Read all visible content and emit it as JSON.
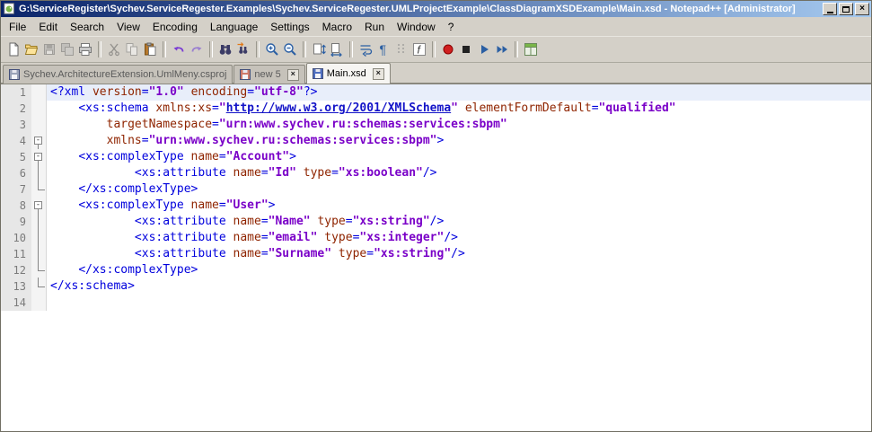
{
  "window": {
    "title": "G:\\ServiceRegister\\Sychev.ServiceRegester.Examples\\Sychev.ServiceRegester.UMLProjectExample\\ClassDiagramXSDExample\\Main.xsd - Notepad++ [Administrator]",
    "controls": [
      "minimize",
      "restore",
      "close"
    ]
  },
  "menu": {
    "items": [
      "File",
      "Edit",
      "Search",
      "View",
      "Encoding",
      "Language",
      "Settings",
      "Macro",
      "Run",
      "Window",
      "?"
    ]
  },
  "toolbar": {
    "groups": [
      [
        "new-file",
        "open",
        "save",
        "save-all",
        "print"
      ],
      [
        "cut",
        "copy",
        "paste"
      ],
      [
        "undo",
        "redo"
      ],
      [
        "find",
        "replace"
      ],
      [
        "zoom-in",
        "zoom-out"
      ],
      [
        "sync-vertical",
        "sync-horizontal"
      ],
      [
        "word-wrap",
        "show-all-characters",
        "show-indent-guide",
        "function-list"
      ],
      [
        "macro-record",
        "macro-stop",
        "macro-play",
        "macro-run-multiple"
      ],
      [
        "doc-switcher"
      ]
    ],
    "disabled": [
      "save",
      "save-all",
      "cut",
      "copy"
    ]
  },
  "tabs": [
    {
      "label": "Sychev.ArchitectureExtension.UmlMeny.csproj",
      "active": false,
      "modified": false,
      "icon_color": "#9aa2b8",
      "has_close": false
    },
    {
      "label": "new 5",
      "active": false,
      "modified": true,
      "icon_color": "#cf7a6a",
      "has_close": true
    },
    {
      "label": "Main.xsd",
      "active": true,
      "modified": false,
      "icon_color": "#4f6fc0",
      "has_close": true
    }
  ],
  "editor": {
    "lines": [
      {
        "n": 1,
        "hl": true,
        "fold": "",
        "tokens": [
          [
            "g",
            "<?xml"
          ],
          [
            "p",
            " "
          ],
          [
            "a",
            "version"
          ],
          [
            "g",
            "="
          ],
          [
            "v",
            "\"1.0\""
          ],
          [
            "p",
            " "
          ],
          [
            "a",
            "encoding"
          ],
          [
            "g",
            "="
          ],
          [
            "v",
            "\"utf-8\""
          ],
          [
            "g",
            "?>"
          ]
        ]
      },
      {
        "n": 2,
        "hl": false,
        "fold": "",
        "tokens": [
          [
            "p",
            "    "
          ],
          [
            "g",
            "<xs:schema"
          ],
          [
            "p",
            " "
          ],
          [
            "a",
            "xmlns:xs"
          ],
          [
            "g",
            "="
          ],
          [
            "v",
            "\""
          ],
          [
            "u",
            "http://www.w3.org/2001/XMLSchema"
          ],
          [
            "v",
            "\""
          ],
          [
            "p",
            " "
          ],
          [
            "a",
            "elementFormDefault"
          ],
          [
            "g",
            "="
          ],
          [
            "v",
            "\"qualified\""
          ]
        ]
      },
      {
        "n": 3,
        "hl": false,
        "fold": "",
        "tokens": [
          [
            "p",
            "        "
          ],
          [
            "a",
            "targetNamespace"
          ],
          [
            "g",
            "="
          ],
          [
            "v",
            "\"urn:www.sychev.ru:schemas:services:sbpm\""
          ]
        ]
      },
      {
        "n": 4,
        "hl": false,
        "fold": "box",
        "tokens": [
          [
            "p",
            "        "
          ],
          [
            "a",
            "xmlns"
          ],
          [
            "g",
            "="
          ],
          [
            "v",
            "\"urn:www.sychev.ru:schemas:services:sbpm\""
          ],
          [
            "g",
            ">"
          ]
        ]
      },
      {
        "n": 5,
        "hl": false,
        "fold": "box",
        "tokens": [
          [
            "p",
            "    "
          ],
          [
            "g",
            "<xs:complexType"
          ],
          [
            "p",
            " "
          ],
          [
            "a",
            "name"
          ],
          [
            "g",
            "="
          ],
          [
            "v",
            "\"Account\""
          ],
          [
            "g",
            ">"
          ]
        ]
      },
      {
        "n": 6,
        "hl": false,
        "fold": "pipe",
        "tokens": [
          [
            "p",
            "            "
          ],
          [
            "g",
            "<xs:attribute"
          ],
          [
            "p",
            " "
          ],
          [
            "a",
            "name"
          ],
          [
            "g",
            "="
          ],
          [
            "v",
            "\"Id\""
          ],
          [
            "p",
            " "
          ],
          [
            "a",
            "type"
          ],
          [
            "g",
            "="
          ],
          [
            "v",
            "\"xs:boolean\""
          ],
          [
            "g",
            "/>"
          ]
        ]
      },
      {
        "n": 7,
        "hl": false,
        "fold": "end",
        "tokens": [
          [
            "p",
            "    "
          ],
          [
            "g",
            "</xs:complexType>"
          ]
        ]
      },
      {
        "n": 8,
        "hl": false,
        "fold": "box",
        "tokens": [
          [
            "p",
            "    "
          ],
          [
            "g",
            "<xs:complexType"
          ],
          [
            "p",
            " "
          ],
          [
            "a",
            "name"
          ],
          [
            "g",
            "="
          ],
          [
            "v",
            "\"User\""
          ],
          [
            "g",
            ">"
          ]
        ]
      },
      {
        "n": 9,
        "hl": false,
        "fold": "pipe",
        "tokens": [
          [
            "p",
            "            "
          ],
          [
            "g",
            "<xs:attribute"
          ],
          [
            "p",
            " "
          ],
          [
            "a",
            "name"
          ],
          [
            "g",
            "="
          ],
          [
            "v",
            "\"Name\""
          ],
          [
            "p",
            " "
          ],
          [
            "a",
            "type"
          ],
          [
            "g",
            "="
          ],
          [
            "v",
            "\"xs:string\""
          ],
          [
            "g",
            "/>"
          ]
        ]
      },
      {
        "n": 10,
        "hl": false,
        "fold": "pipe",
        "tokens": [
          [
            "p",
            "            "
          ],
          [
            "g",
            "<xs:attribute"
          ],
          [
            "p",
            " "
          ],
          [
            "a",
            "name"
          ],
          [
            "g",
            "="
          ],
          [
            "v",
            "\"email\""
          ],
          [
            "p",
            " "
          ],
          [
            "a",
            "type"
          ],
          [
            "g",
            "="
          ],
          [
            "v",
            "\"xs:integer\""
          ],
          [
            "g",
            "/>"
          ]
        ]
      },
      {
        "n": 11,
        "hl": false,
        "fold": "pipe",
        "tokens": [
          [
            "p",
            "            "
          ],
          [
            "g",
            "<xs:attribute"
          ],
          [
            "p",
            " "
          ],
          [
            "a",
            "name"
          ],
          [
            "g",
            "="
          ],
          [
            "v",
            "\"Surname\""
          ],
          [
            "p",
            " "
          ],
          [
            "a",
            "type"
          ],
          [
            "g",
            "="
          ],
          [
            "v",
            "\"xs:string\""
          ],
          [
            "g",
            "/>"
          ]
        ]
      },
      {
        "n": 12,
        "hl": false,
        "fold": "end",
        "tokens": [
          [
            "p",
            "    "
          ],
          [
            "g",
            "</xs:complexType>"
          ]
        ]
      },
      {
        "n": 13,
        "hl": false,
        "fold": "end",
        "tokens": [
          [
            "g",
            "</xs:schema>"
          ]
        ]
      },
      {
        "n": 14,
        "hl": false,
        "fold": "",
        "tokens": []
      }
    ]
  },
  "colors": {
    "tb1": "#0a246a",
    "tb2": "#a6caf0",
    "chrome": "#d4d0c8",
    "tag": "#0000dd",
    "attr": "#8f2400",
    "val": "#7a00c8",
    "url": "#1414c8",
    "curline": "#e8eefa",
    "lnum": "#7b7b7b"
  }
}
